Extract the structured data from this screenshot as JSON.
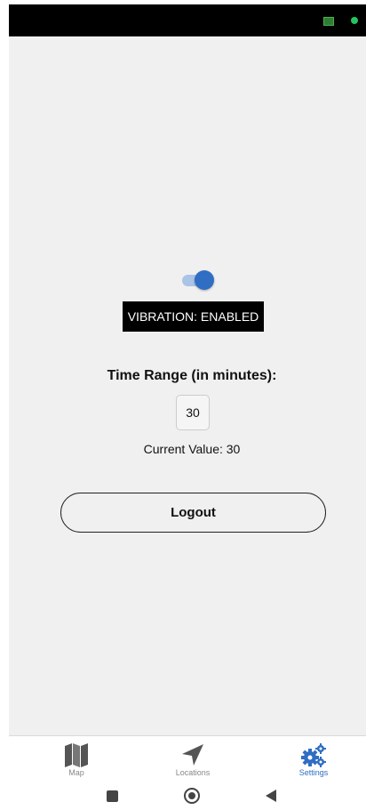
{
  "settings": {
    "vibration_label": "VIBRATION: ENABLED",
    "vibration_enabled": true,
    "time_range_title": "Time Range (in minutes):",
    "time_range_value": "30",
    "current_value_text": "Current Value: 30",
    "logout_label": "Logout"
  },
  "tabs": [
    {
      "label": "Map",
      "icon": "map-icon",
      "active": false
    },
    {
      "label": "Locations",
      "icon": "navigation-arrow-icon",
      "active": false
    },
    {
      "label": "Settings",
      "icon": "gears-icon",
      "active": true
    }
  ],
  "colors": {
    "accent": "#2f6ec2",
    "toggle_track": "#a9c4e6",
    "background": "#f0f0f0",
    "inactive_icon": "#555555"
  }
}
